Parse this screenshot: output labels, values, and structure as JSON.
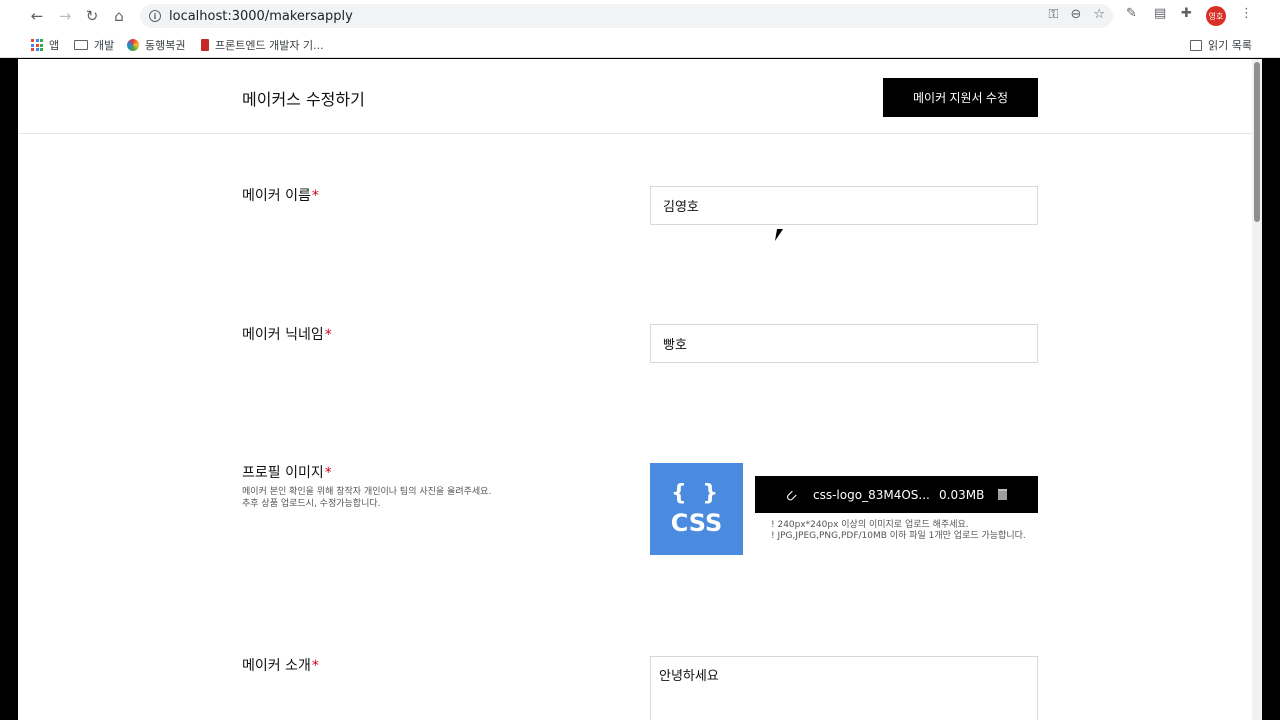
{
  "browser": {
    "url": "localhost:3000/makersapply",
    "profile_initials": "영호",
    "bookmarks": [
      {
        "label": "앱"
      },
      {
        "label": "개발"
      },
      {
        "label": "동행복권"
      },
      {
        "label": "프론트엔드 개발자 기..."
      }
    ],
    "reading_list": "읽기 목록"
  },
  "header": {
    "title": "메이커스 수정하기",
    "submit_label": "메이커 지원서 수정"
  },
  "form": {
    "required_mark": "*",
    "name": {
      "label": "메이커 이름",
      "value": "김영호"
    },
    "nickname": {
      "label": "메이커 닉네임",
      "value": "빵호"
    },
    "profile": {
      "label": "프로필 이미지",
      "help_line1": "메이커 본인 확인을 위해 창작자 개인이나 팀의 사진을 올려주세요.",
      "help_line2": "추후 상품 업로드시, 수정가능합니다.",
      "thumb_braces": "{ }",
      "thumb_text": "CSS",
      "file_name": "css-logo_83M4OS...",
      "file_size": "0.03MB",
      "note1": "! 240px*240px 이상의 이미지로 업로드 해주세요.",
      "note2": "! JPG,JPEG,PNG,PDF/10MB 이하 파일 1개만 업로드 가능합니다."
    },
    "intro": {
      "label": "메이커 소개",
      "value": "안녕하세요"
    }
  }
}
